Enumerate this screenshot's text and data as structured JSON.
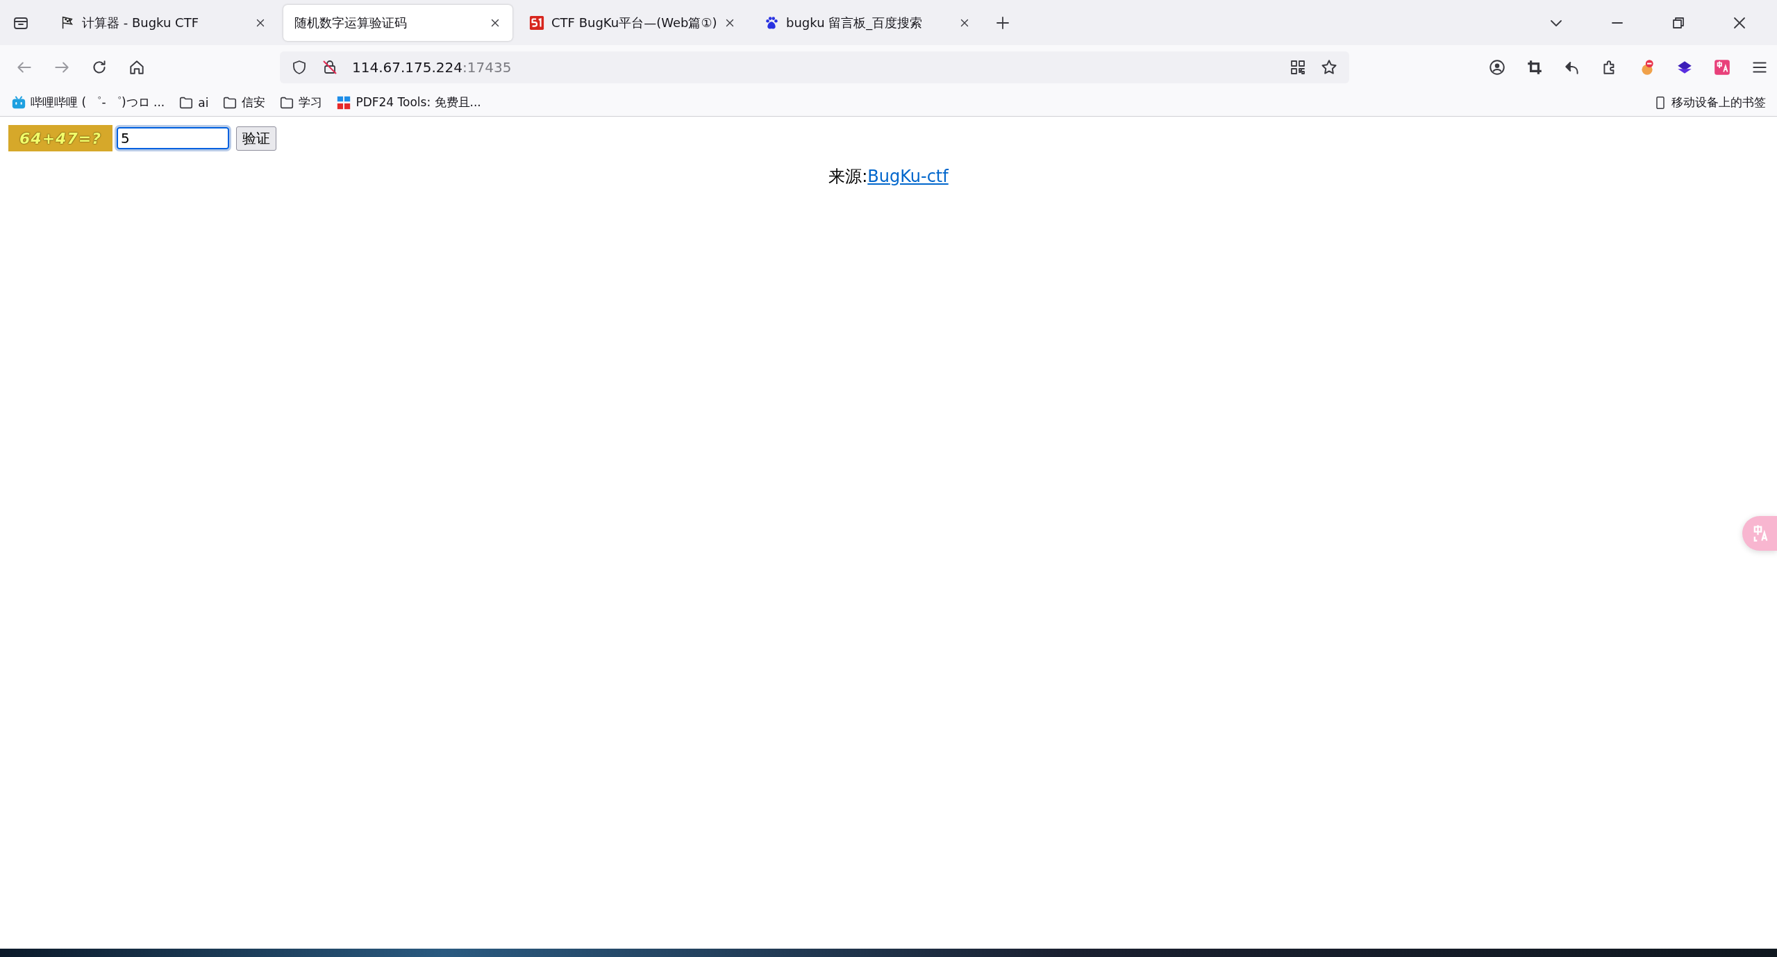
{
  "tabs": [
    {
      "title": "计算器 - Bugku CTF",
      "kind": "flag",
      "selected": false
    },
    {
      "title": "随机数字运算验证码",
      "kind": "none",
      "selected": true
    },
    {
      "title": "CTF BugKu平台—(Web篇①)",
      "kind": "fiftyone",
      "selected": false
    },
    {
      "title": "bugku 留言板_百度搜索",
      "kind": "paw",
      "selected": false
    }
  ],
  "address": {
    "host": "114.67.175.224",
    "port": ":17435"
  },
  "bookmarks": [
    {
      "label": "哔哩哔哩 ( ゜- ゜)つロ ...",
      "kind": "tv"
    },
    {
      "label": "ai",
      "kind": "folder"
    },
    {
      "label": "信安",
      "kind": "folder"
    },
    {
      "label": "学习",
      "kind": "folder"
    },
    {
      "label": "PDF24 Tools: 免费且...",
      "kind": "pdf"
    }
  ],
  "mobile_bookmarks": "移动设备上的书签",
  "page": {
    "captcha": "64+47=?",
    "answer": "5",
    "verify_button": "验证",
    "source_label": "来源:",
    "source_link": "BugKu-ctf"
  }
}
